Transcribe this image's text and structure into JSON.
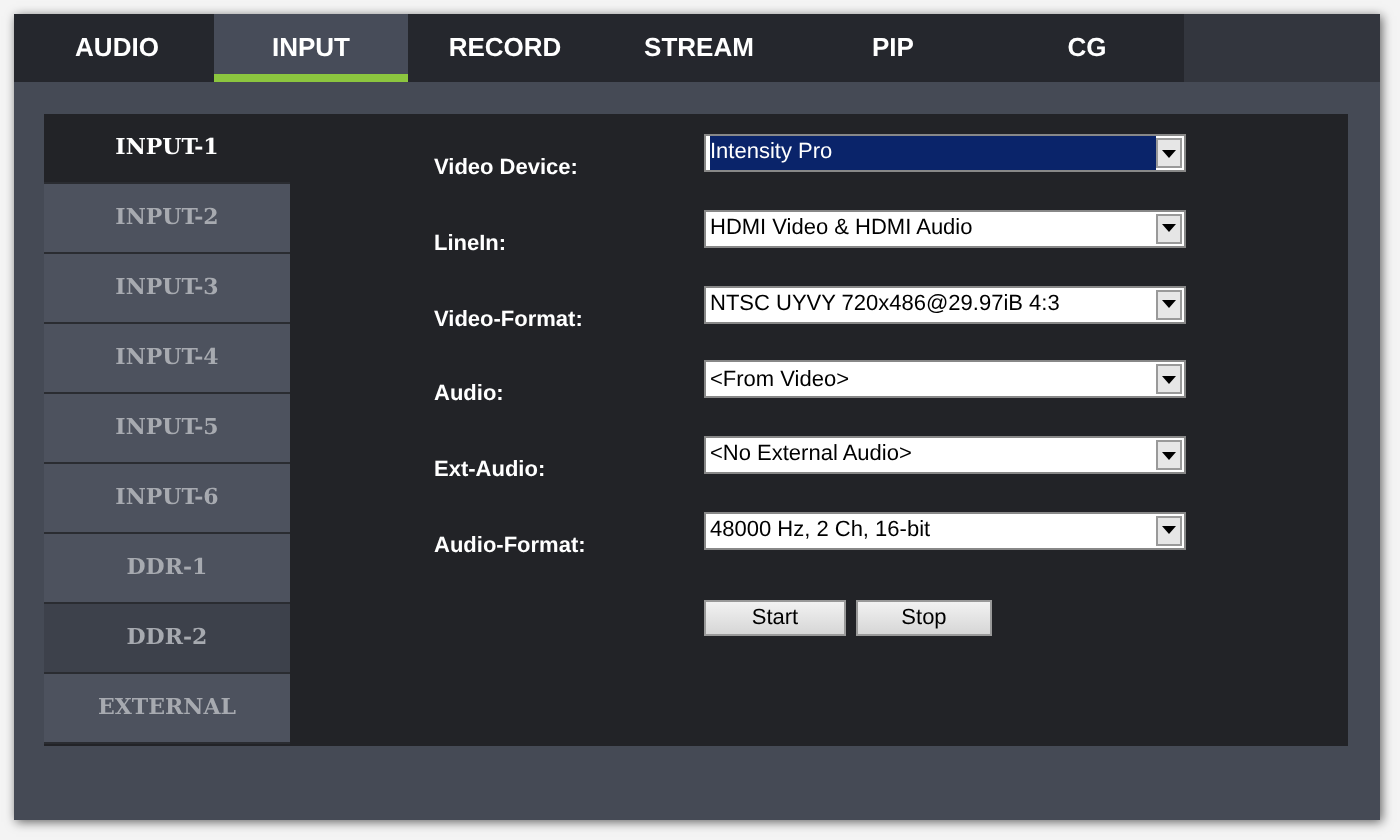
{
  "tabs": [
    {
      "label": "AUDIO",
      "selected": false
    },
    {
      "label": "INPUT",
      "selected": true
    },
    {
      "label": "RECORD",
      "selected": false
    },
    {
      "label": "STREAM",
      "selected": false
    },
    {
      "label": "PIP",
      "selected": false
    },
    {
      "label": "CG",
      "selected": false
    }
  ],
  "sidebar": {
    "items": [
      {
        "label": "INPUT-1",
        "selected": true,
        "hovered": false
      },
      {
        "label": "INPUT-2",
        "selected": false,
        "hovered": false
      },
      {
        "label": "INPUT-3",
        "selected": false,
        "hovered": false
      },
      {
        "label": "INPUT-4",
        "selected": false,
        "hovered": false
      },
      {
        "label": "INPUT-5",
        "selected": false,
        "hovered": false
      },
      {
        "label": "INPUT-6",
        "selected": false,
        "hovered": false
      },
      {
        "label": "DDR-1",
        "selected": false,
        "hovered": false
      },
      {
        "label": "DDR-2",
        "selected": false,
        "hovered": true
      },
      {
        "label": "EXTERNAL",
        "selected": false,
        "hovered": false
      }
    ]
  },
  "form": {
    "fields": [
      {
        "label": "Video Device:",
        "value": "Intensity Pro",
        "focused": true
      },
      {
        "label": "LineIn:",
        "value": "HDMI Video & HDMI Audio",
        "focused": false
      },
      {
        "label": "Video-Format:",
        "value": "NTSC UYVY 720x486@29.97iB 4:3",
        "focused": false
      },
      {
        "label": "Audio:",
        "value": "<From Video>",
        "focused": false
      },
      {
        "label": "Ext-Audio:",
        "value": "<No External Audio>",
        "focused": false
      },
      {
        "label": "Audio-Format:",
        "value": "48000 Hz, 2 Ch, 16-bit",
        "focused": false
      }
    ],
    "buttons": [
      "Start",
      "Stop"
    ]
  }
}
